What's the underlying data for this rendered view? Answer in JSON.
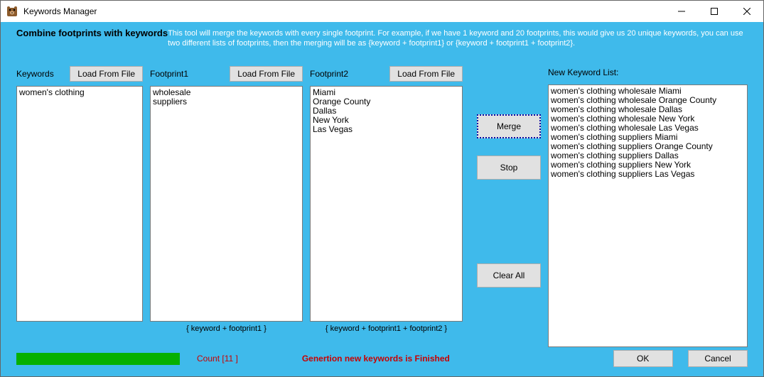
{
  "title": "Keywords Manager",
  "header": {
    "bold": "Combine footprints with keywords",
    "desc": "This tool will merge the keywords with every single footprint. For example, if we have 1 keyword and 20 footprints, this would give us 20 unique keywords, you can use two different lists of footprints, then the merging will be as {keyword + footprint1} or {keyword + footprint1 + footprint2}."
  },
  "labels": {
    "keywords": "Keywords",
    "footprint1": "Footprint1",
    "footprint2": "Footprint2",
    "newList": "New Keyword List:",
    "loadFromFile": "Load From File",
    "merge": "Merge",
    "stop": "Stop",
    "clearAll": "Clear All",
    "ok": "OK",
    "cancel": "Cancel",
    "hint1": "{ keyword + footprint1 }",
    "hint2": "{ keyword + footprint1 + footprint2 }"
  },
  "inputs": {
    "keywords": "women's clothing",
    "footprint1": "wholesale\nsuppliers",
    "footprint2": "Miami\nOrange County\nDallas\nNew York\nLas Vegas"
  },
  "output": [
    "women's clothing wholesale Miami",
    "women's clothing wholesale Orange County",
    "women's clothing wholesale Dallas",
    "women's clothing wholesale New York",
    "women's clothing wholesale Las Vegas",
    "women's clothing suppliers Miami",
    "women's clothing suppliers Orange County",
    "women's clothing suppliers Dallas",
    "women's clothing suppliers New York",
    "women's clothing suppliers Las Vegas"
  ],
  "footer": {
    "count": "Count [11 ]",
    "status": "Genertion new keywords  is Finished"
  }
}
